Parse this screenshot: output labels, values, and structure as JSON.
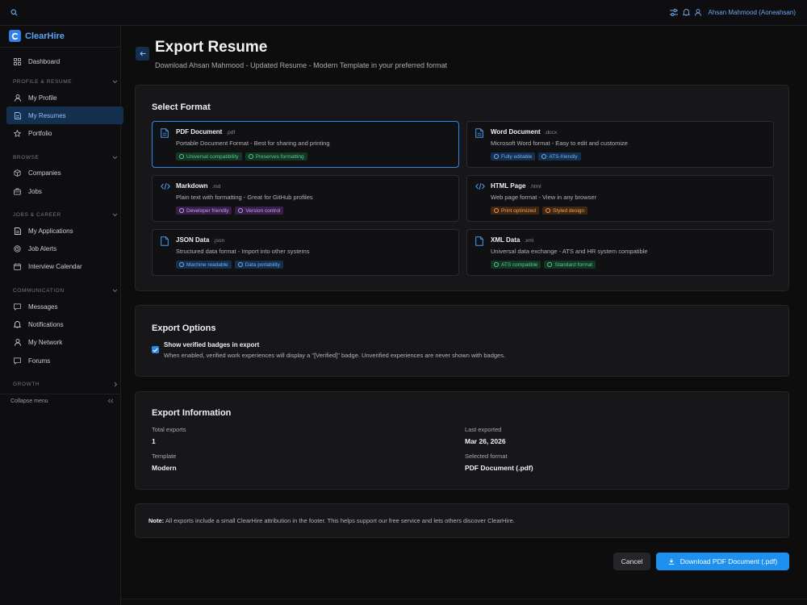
{
  "app": {
    "name": "ClearHire"
  },
  "topbar": {
    "user_name": "Ahsan Mahmood (Aoneahsan)"
  },
  "sidebar": {
    "dashboard": "Dashboard",
    "sections": {
      "profile": "PROFILE & RESUME",
      "browse": "BROWSE",
      "jobs": "JOBS & CAREER",
      "communication": "COMMUNICATION",
      "growth": "GROWTH"
    },
    "items": {
      "my_profile": "My Profile",
      "my_resumes": "My Resumes",
      "portfolio": "Portfolio",
      "companies": "Companies",
      "jobs": "Jobs",
      "my_applications": "My Applications",
      "job_alerts": "Job Alerts",
      "interview_calendar": "Interview Calendar",
      "messages": "Messages",
      "notifications": "Notifications",
      "my_network": "My Network",
      "forums": "Forums"
    },
    "collapse": "Collapse menu"
  },
  "page": {
    "title": "Export Resume",
    "subtitle": "Download Ahsan Mahmood - Updated Resume - Modern Template in your preferred format"
  },
  "formats": {
    "title": "Select Format",
    "items": [
      {
        "name": "PDF Document",
        "ext": ".pdf",
        "desc": "Portable Document Format - Best for sharing and printing",
        "tags": [
          "Universal compatibility",
          "Preserves formatting"
        ],
        "color": "green",
        "icon": "document-icon",
        "selected": true
      },
      {
        "name": "Word Document",
        "ext": ".docx",
        "desc": "Microsoft Word format - Easy to edit and customize",
        "tags": [
          "Fully editable",
          "ATS-friendly"
        ],
        "color": "blue",
        "icon": "document-icon",
        "selected": false
      },
      {
        "name": "Markdown",
        "ext": ".md",
        "desc": "Plain text with formatting - Great for GitHub profiles",
        "tags": [
          "Developer friendly",
          "Version control"
        ],
        "color": "purple",
        "icon": "code-icon",
        "selected": false
      },
      {
        "name": "HTML Page",
        "ext": ".html",
        "desc": "Web page format - View in any browser",
        "tags": [
          "Print optimized",
          "Styled design"
        ],
        "color": "orange",
        "icon": "code-icon",
        "selected": false
      },
      {
        "name": "JSON Data",
        "ext": ".json",
        "desc": "Structured data format - Import into other systems",
        "tags": [
          "Machine readable",
          "Data portability"
        ],
        "color": "blue",
        "icon": "file-icon",
        "selected": false
      },
      {
        "name": "XML Data",
        "ext": ".xml",
        "desc": "Universal data exchange - ATS and HR system compatible",
        "tags": [
          "ATS compatible",
          "Standard format"
        ],
        "color": "green",
        "icon": "file-icon",
        "selected": false
      }
    ]
  },
  "options": {
    "title": "Export Options",
    "badge_label": "Show verified badges in export",
    "badge_desc": "When enabled, verified work experiences will display a \"[Verified]\" badge. Unverified experiences are never shown with badges.",
    "badge_checked": true
  },
  "info": {
    "title": "Export Information",
    "total_exports_label": "Total exports",
    "total_exports": "1",
    "last_exported_label": "Last exported",
    "last_exported": "Mar 26, 2026",
    "template_label": "Template",
    "template": "Modern",
    "selected_format_label": "Selected format",
    "selected_format": "PDF Document (.pdf)"
  },
  "note": {
    "prefix": "Note:",
    "text": " All exports include a small ClearHire attribution in the footer. This helps support our free service and lets others discover ClearHire."
  },
  "actions": {
    "cancel": "Cancel",
    "download": "Download PDF Document (.pdf)"
  },
  "colors": {
    "accent": "#2f87e8",
    "active_nav_bg": "#15304f",
    "background": "#0d0d0e",
    "card": "#17171a"
  }
}
